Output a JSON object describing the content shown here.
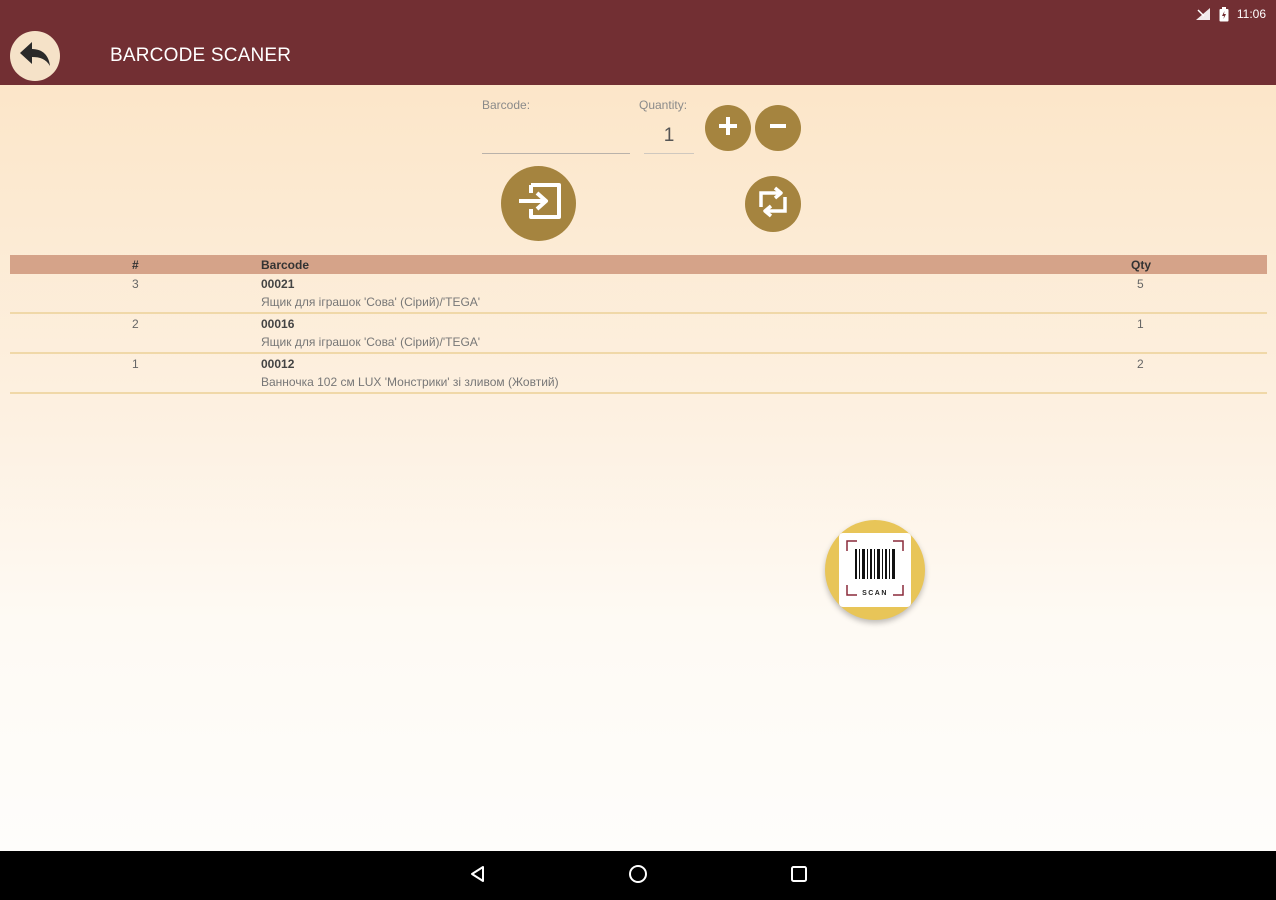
{
  "status_bar": {
    "time": "11:06"
  },
  "app_bar": {
    "title": "BARCODE SCANER"
  },
  "form": {
    "barcode_label": "Barcode:",
    "barcode_value": "",
    "quantity_label": "Quantity:",
    "quantity_value": "1"
  },
  "table": {
    "headers": {
      "num": "#",
      "barcode": "Barcode",
      "qty": "Qty"
    },
    "rows": [
      {
        "num": "3",
        "barcode": "00021",
        "description": "Ящик для іграшок 'Сова' (Сірий)/'TEGA'",
        "qty": "5"
      },
      {
        "num": "2",
        "barcode": "00016",
        "description": "Ящик для іграшок 'Сова' (Сірий)/'TEGA'",
        "qty": "1"
      },
      {
        "num": "1",
        "barcode": "00012",
        "description": "Ванночка 102 см LUX 'Монстрики' зі зливом (Жовтий)",
        "qty": "2"
      }
    ]
  },
  "scan_button": {
    "label": "SCAN"
  },
  "icons": {
    "back": "back-arrow-icon",
    "plus": "plus-icon",
    "minus": "minus-icon",
    "submit": "input-arrow-icon",
    "sync": "sync-icon",
    "scan": "barcode-icon",
    "nav_back": "triangle-back-icon",
    "nav_home": "circle-home-icon",
    "nav_recent": "square-recent-icon"
  },
  "colors": {
    "primary": "#722f33",
    "accent": "#a5843f",
    "table_header": "#d5a389",
    "scan_fab": "#e8c558"
  }
}
